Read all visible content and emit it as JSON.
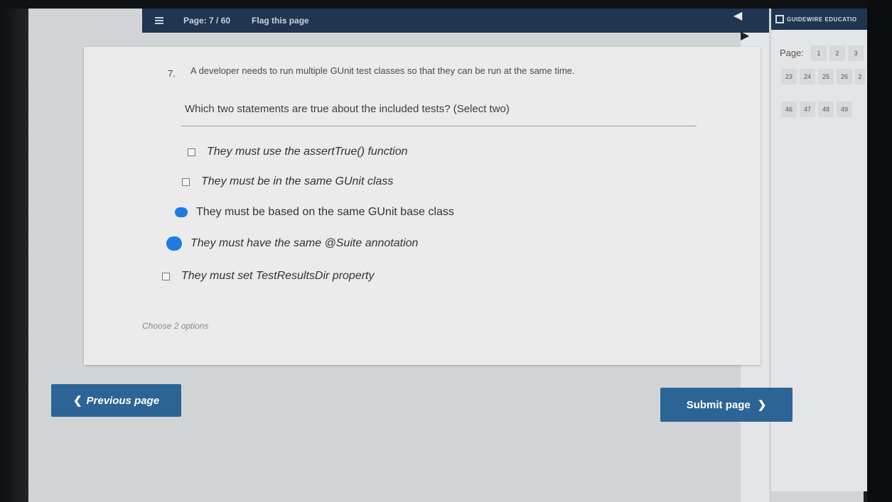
{
  "topbar": {
    "page_indicator": "Page: 7 / 60",
    "flag_label": "Flag this page"
  },
  "brand": {
    "name": "GUIDEWIRE EDUCATIO"
  },
  "page_nav": {
    "label": "Page:",
    "row1": [
      "1",
      "2",
      "3"
    ],
    "row2": [
      "23",
      "24",
      "25",
      "26",
      "2"
    ],
    "row3": [
      "46",
      "47",
      "48",
      "49"
    ]
  },
  "question": {
    "number": "7.",
    "text": "A developer needs to run multiple GUnit test classes so that they can be run at the same time.",
    "prompt": "Which two statements are true about the included tests? (Select two)",
    "options": [
      {
        "label": "They must use the assertTrue() function",
        "checked": false
      },
      {
        "label": "They must be in the same GUnit class",
        "checked": false
      },
      {
        "label": "They must be based on the same GUnit base class",
        "checked": true
      },
      {
        "label": "They must have the same @Suite annotation",
        "checked": true
      },
      {
        "label": "They must set TestResultsDir property",
        "checked": false
      }
    ],
    "hint": "Choose 2 options"
  },
  "buttons": {
    "previous": "Previous page",
    "submit": "Submit page"
  },
  "colors": {
    "header_bg": "#1f3550",
    "button_bg": "#2d6496",
    "checked": "#1e7be0"
  }
}
